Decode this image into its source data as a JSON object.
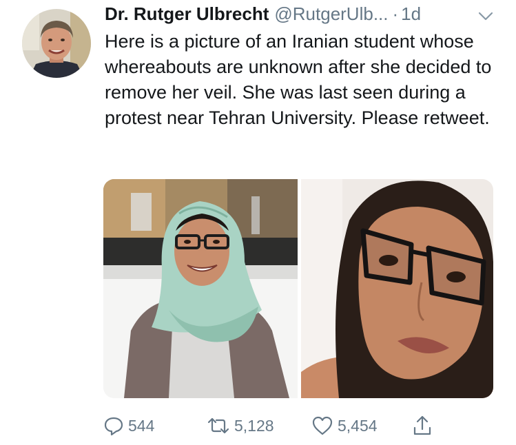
{
  "tweet": {
    "author_name": "Dr. Rutger Ulbrecht",
    "author_handle": "@RutgerUlb...",
    "separator": "·",
    "timestamp": "1d",
    "text": "Here is a picture of an Iranian student whose whereabouts are unknown after she decided to remove her veil. She was last seen during a protest near Tehran University. Please retweet.",
    "reply_count": "544",
    "retweet_count": "5,128",
    "like_count": "5,454"
  },
  "icons": {
    "reply": "reply-icon",
    "retweet": "retweet-icon",
    "like": "heart-icon",
    "share": "share-icon",
    "menu": "chevron-down-icon"
  },
  "colors": {
    "text_primary": "#14171a",
    "text_secondary": "#657786",
    "icon_gray": "#657786",
    "scarf_mint": "#a9d3c4",
    "skin_tone": "#c98e6d"
  }
}
